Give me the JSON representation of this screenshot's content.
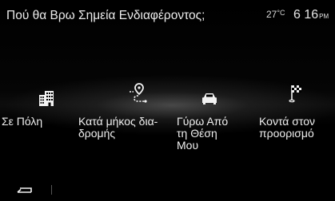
{
  "header": {
    "title": "Πού θα Βρω Σημεία Ενδιαφέροντος;",
    "temperature": "27",
    "temperature_unit": "°C",
    "time": "6 16",
    "time_suffix": "PM"
  },
  "options": [
    {
      "id": "city",
      "label": "Σε Πόλη",
      "icon": "city-buildings-icon"
    },
    {
      "id": "route",
      "label": "Κατά μήκος δια-\nδρομής",
      "icon": "route-pin-icon"
    },
    {
      "id": "around",
      "label": "Γύρω Από\nτη Θέση\nΜου",
      "icon": "car-icon"
    },
    {
      "id": "dest",
      "label": "Κοντά στον\nπροορισμό",
      "icon": "checkered-flag-icon"
    }
  ],
  "footer": {
    "back_icon": "back-arrow-icon"
  }
}
